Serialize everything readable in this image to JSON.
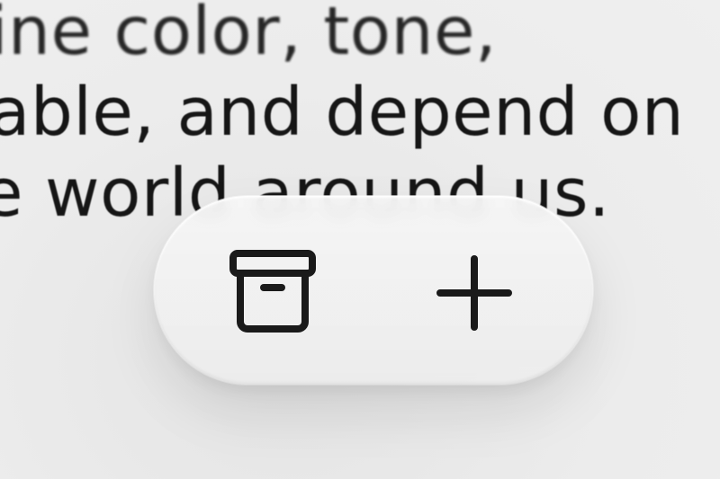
{
  "background_text": {
    "line1": "ine color, tone,",
    "line2": "able, and depend on",
    "line3": "e world around us."
  },
  "toolbar": {
    "archive_icon": "archive-box-icon",
    "add_icon": "plus-icon"
  },
  "colors": {
    "background": "#e7e7e7",
    "text": "#161616",
    "icon": "#1a1a1a",
    "pill": "#f0f0f0"
  }
}
